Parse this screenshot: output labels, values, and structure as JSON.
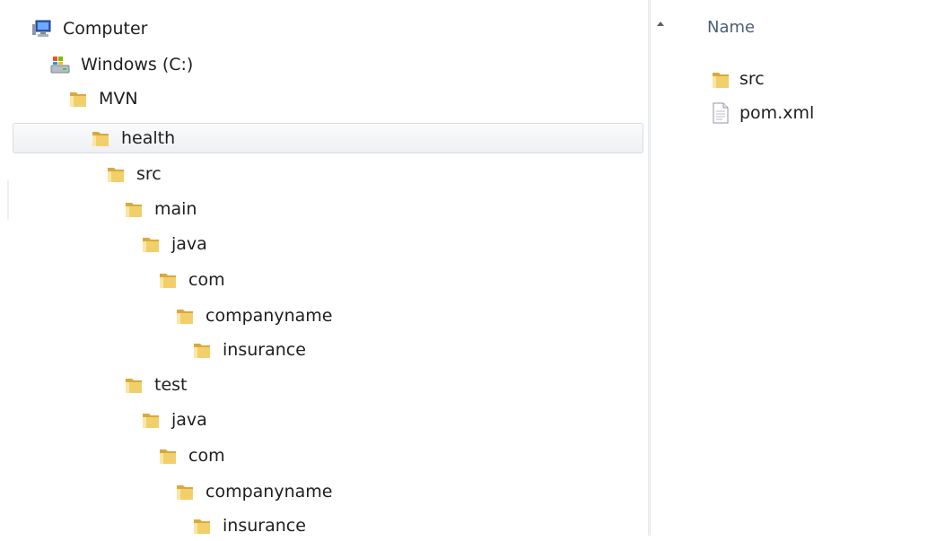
{
  "nav": {
    "items": [
      {
        "label": "Computer",
        "icon": "computer-icon",
        "indent": 0
      },
      {
        "label": "Windows (C:)",
        "icon": "drive-icon",
        "indent": 1
      },
      {
        "label": "MVN",
        "icon": "folder-icon",
        "indent": 2
      },
      {
        "label": "health",
        "icon": "folder-icon",
        "indent": 3,
        "selected": true
      },
      {
        "label": "src",
        "icon": "folder-icon",
        "indent": 4
      },
      {
        "label": "main",
        "icon": "folder-icon",
        "indent": 5
      },
      {
        "label": "java",
        "icon": "folder-icon",
        "indent": 6
      },
      {
        "label": "com",
        "icon": "folder-icon",
        "indent": 7
      },
      {
        "label": "companyname",
        "icon": "folder-icon",
        "indent": 8
      },
      {
        "label": "insurance",
        "icon": "folder-icon",
        "indent": 9
      },
      {
        "label": "test",
        "icon": "folder-icon",
        "indent": 5
      },
      {
        "label": "java",
        "icon": "folder-icon",
        "indent": 6
      },
      {
        "label": "com",
        "icon": "folder-icon",
        "indent": 7
      },
      {
        "label": "companyname",
        "icon": "folder-icon",
        "indent": 8
      },
      {
        "label": "insurance",
        "icon": "folder-icon",
        "indent": 9
      }
    ]
  },
  "content": {
    "column_header": "Name",
    "files": [
      {
        "name": "src",
        "icon": "folder-icon"
      },
      {
        "name": "pom.xml",
        "icon": "document-icon"
      }
    ]
  },
  "colors": {
    "folder": "#e9c15a",
    "header_text": "#4a6078",
    "selection_border": "#d9dce1"
  }
}
